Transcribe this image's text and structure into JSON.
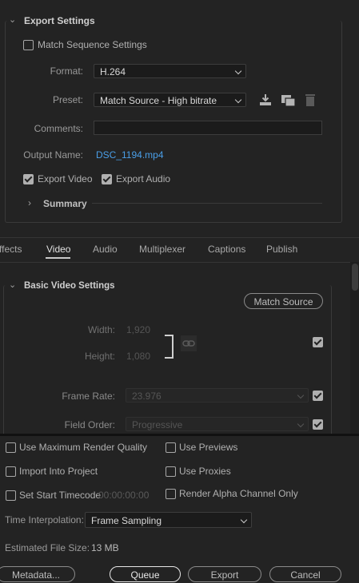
{
  "export_settings": {
    "title": "Export Settings",
    "match_sequence_label": "Match Sequence Settings",
    "match_sequence_checked": false,
    "format_label": "Format:",
    "format_value": "H.264",
    "preset_label": "Preset:",
    "preset_value": "Match Source - High bitrate",
    "comments_label": "Comments:",
    "comments_value": "",
    "output_name_label": "Output Name:",
    "output_name_value": "DSC_1194.mp4",
    "export_video_label": "Export Video",
    "export_video_checked": true,
    "export_audio_label": "Export Audio",
    "export_audio_checked": true,
    "summary_label": "Summary"
  },
  "tabs": [
    {
      "label": "ffects",
      "active": false
    },
    {
      "label": "Video",
      "active": true
    },
    {
      "label": "Audio",
      "active": false
    },
    {
      "label": "Multiplexer",
      "active": false
    },
    {
      "label": "Captions",
      "active": false
    },
    {
      "label": "Publish",
      "active": false
    }
  ],
  "basic_video": {
    "title": "Basic Video Settings",
    "match_source_button": "Match Source",
    "width_label": "Width:",
    "width_value": "1,920",
    "height_label": "Height:",
    "height_value": "1,080",
    "frame_rate_label": "Frame Rate:",
    "frame_rate_value": "23.976",
    "frame_rate_checked": true,
    "field_order_label": "Field Order:",
    "field_order_value": "Progressive",
    "field_order_checked": true,
    "dimensions_checked": true
  },
  "options": {
    "max_render_quality": "Use Maximum Render Quality",
    "use_previews": "Use Previews",
    "import_into_project": "Import Into Project",
    "use_proxies": "Use Proxies",
    "set_start_timecode": "Set Start Timecode",
    "start_timecode_value": "00:00:00:00",
    "render_alpha": "Render Alpha Channel Only"
  },
  "time_interpolation": {
    "label": "Time Interpolation:",
    "value": "Frame Sampling"
  },
  "estimated_size": {
    "label": "Estimated File Size:",
    "value": "13 MB"
  },
  "footer": {
    "metadata": "Metadata...",
    "queue": "Queue",
    "export": "Export",
    "cancel": "Cancel"
  },
  "colors": {
    "background": "#232323",
    "link_blue": "#4a9fe8",
    "accent_text": "#e0e0e0"
  }
}
